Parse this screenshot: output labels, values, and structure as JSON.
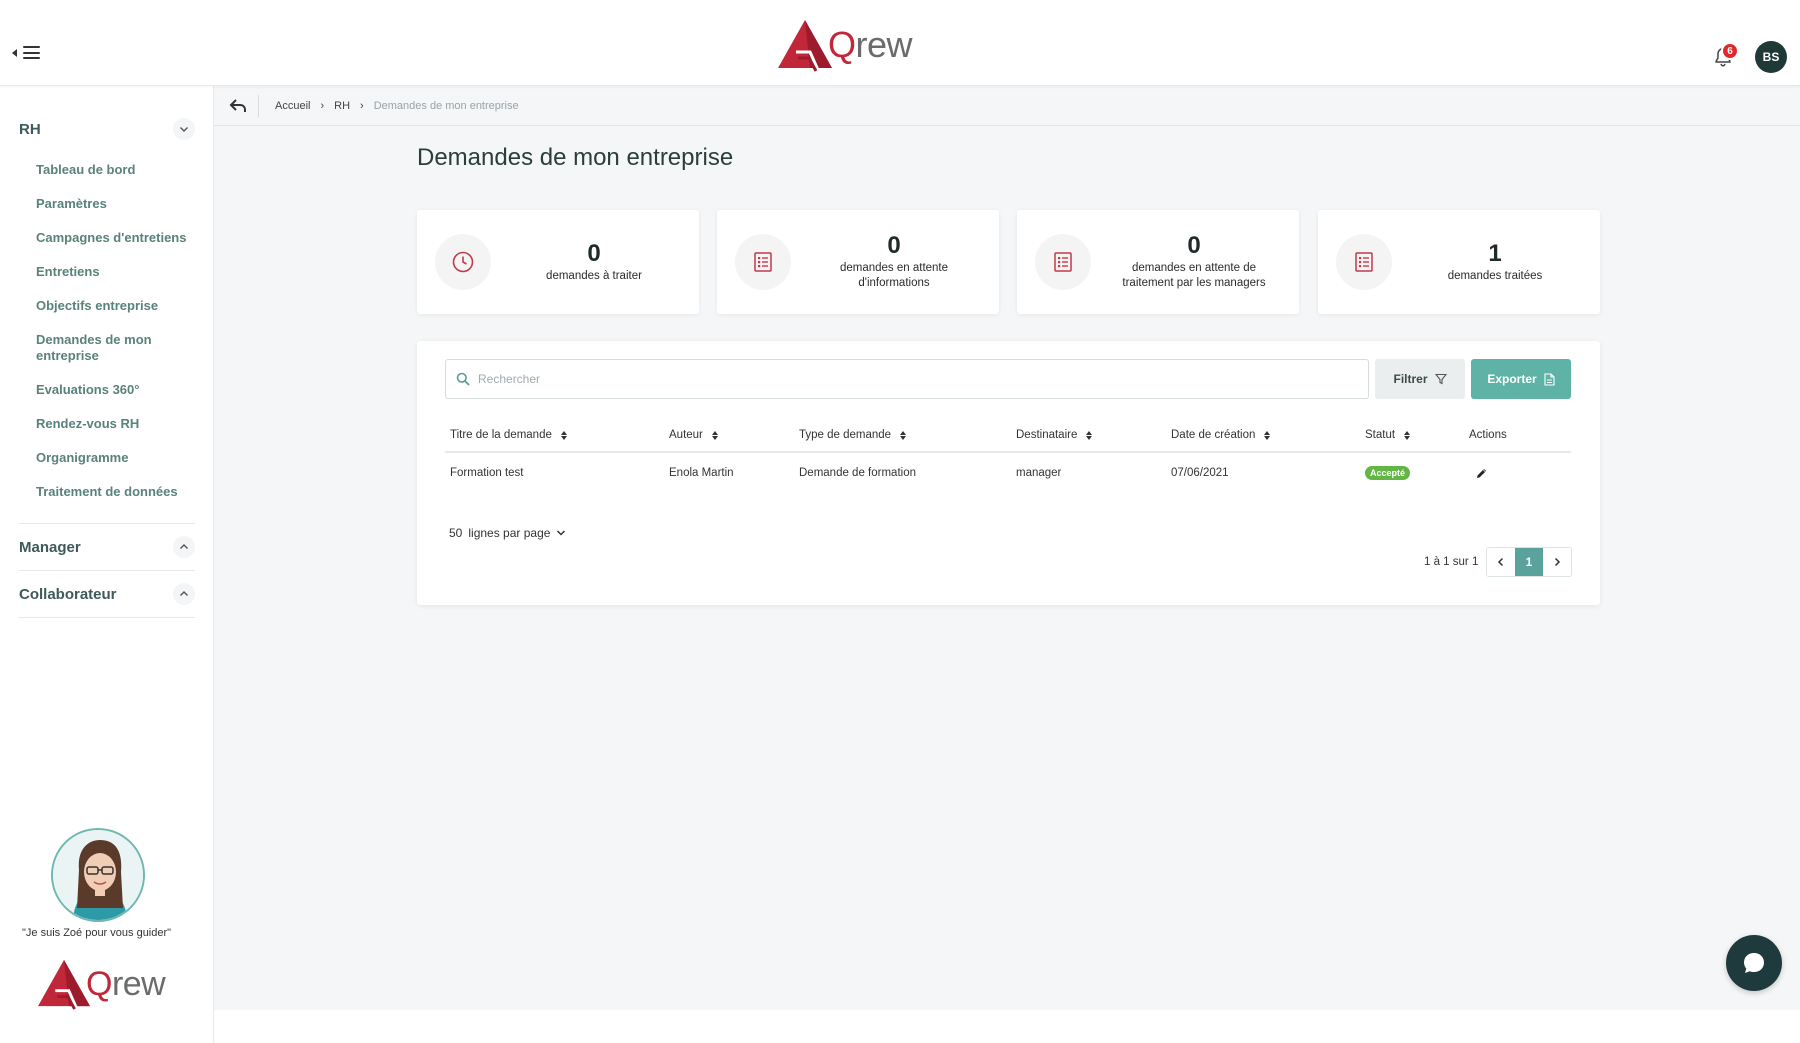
{
  "app": {
    "brand_letter": "Q",
    "brand_rest": "rew",
    "user_initials": "BS",
    "notification_count": "6"
  },
  "sidebar": {
    "sections": [
      {
        "title": "RH",
        "expanded": true
      },
      {
        "title": "Manager",
        "expanded": false
      },
      {
        "title": "Collaborateur",
        "expanded": false
      }
    ],
    "items": [
      {
        "label": "Tableau de bord"
      },
      {
        "label": "Paramètres"
      },
      {
        "label": "Campagnes d'entretiens"
      },
      {
        "label": "Entretiens"
      },
      {
        "label": "Objectifs entreprise"
      },
      {
        "label": "Demandes de mon entreprise"
      },
      {
        "label": "Evaluations 360°"
      },
      {
        "label": "Rendez-vous RH"
      },
      {
        "label": "Organigramme"
      },
      {
        "label": "Traitement de données"
      }
    ],
    "zoe_text": "\"Je suis Zoé pour vous guider\""
  },
  "breadcrumb": {
    "items": [
      "Accueil",
      "RH",
      "Demandes de mon entreprise"
    ]
  },
  "page": {
    "title": "Demandes de mon entreprise"
  },
  "stats": [
    {
      "value": "0",
      "label": "demandes à traiter",
      "icon": "clock-icon"
    },
    {
      "value": "0",
      "label": "demandes en attente d'informations",
      "icon": "list-icon"
    },
    {
      "value": "0",
      "label": "demandes en attente de traitement par les managers",
      "icon": "list-icon"
    },
    {
      "value": "1",
      "label": "demandes traitées",
      "icon": "list-icon"
    }
  ],
  "toolbar": {
    "search_placeholder": "Rechercher",
    "filter_label": "Filtrer",
    "export_label": "Exporter"
  },
  "table": {
    "columns": [
      "Titre de la demande",
      "Auteur",
      "Type de demande",
      "Destinataire",
      "Date de création",
      "Statut",
      "Actions"
    ],
    "rows": [
      {
        "title": "Formation test",
        "author": "Enola Martin",
        "type": "Demande de formation",
        "recipient": "manager",
        "date": "07/06/2021",
        "status": "Accepté"
      }
    ]
  },
  "pagination": {
    "rows_per_page": "50",
    "rows_per_page_label": "lignes par page",
    "info": "1 à 1 sur 1",
    "current_page": "1"
  },
  "colors": {
    "brand_red": "#c0283a",
    "accent_teal": "#5fb2a6",
    "nav_text": "#58827a",
    "status_accepted": "#62b744"
  }
}
